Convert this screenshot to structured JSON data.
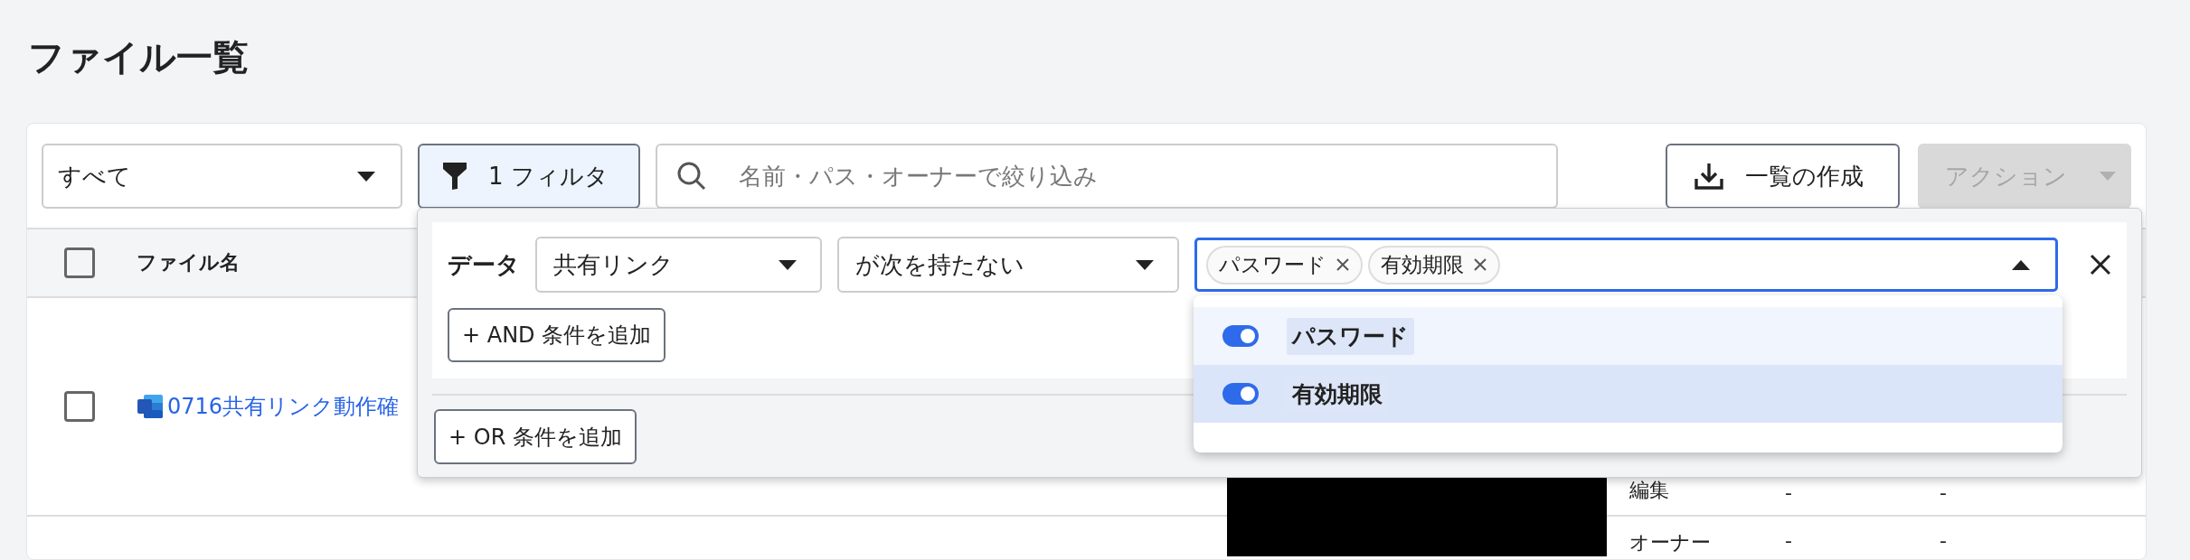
{
  "title": "ファイル一覧",
  "toolbar": {
    "scope": {
      "value": "すべて"
    },
    "filter_button": {
      "label": "1 フィルタ",
      "active": true
    },
    "search": {
      "placeholder": "名前・パス・オーナーで絞り込み"
    },
    "export_button": {
      "label": "一覧の作成"
    },
    "action_button": {
      "label": "アクション",
      "disabled": true
    }
  },
  "table": {
    "select_all": {
      "checked": false
    },
    "columns": [
      {
        "label": "ファイル名"
      }
    ],
    "rows": [
      {
        "checked": false,
        "kind": "word",
        "name": "0716共有リンク動作確",
        "permissions": [
          {
            "role": "編集",
            "column_4": "-",
            "column_5": "-"
          }
        ]
      },
      {
        "permissions": [
          {
            "role": "オーナー",
            "column_4": "-",
            "column_5": "-"
          }
        ]
      }
    ]
  },
  "filter_panel": {
    "conditions": [
      {
        "label": "データ",
        "field": "共有リンク",
        "operator": "が次を持たない",
        "values": [
          {
            "label": "パスワード"
          },
          {
            "label": "有効期限"
          }
        ],
        "expanded": true
      }
    ],
    "and_button": "+ AND 条件を追加",
    "or_button": "+ OR 条件を追加",
    "options": [
      {
        "label": "パスワード",
        "on": true,
        "highlighted": false
      },
      {
        "label": "有効期限",
        "on": true,
        "highlighted": true
      }
    ]
  }
}
